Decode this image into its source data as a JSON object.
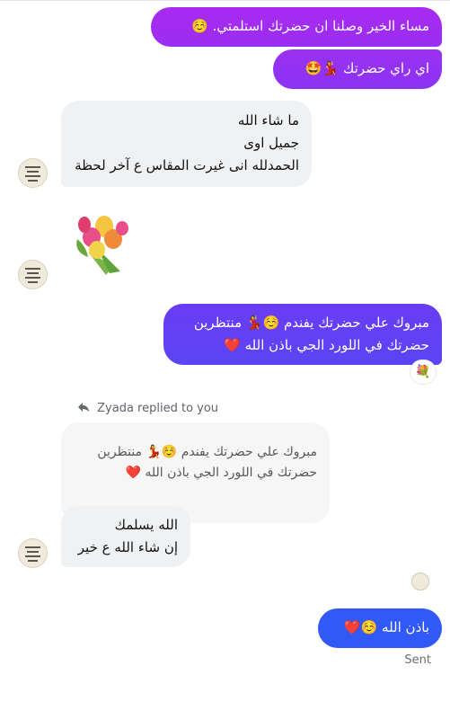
{
  "messages": {
    "m1_text": "مساء الخير وصلنا ان حضرتك استلمتي. ☺️",
    "m2_text": "اي راي حضرتك 💃🤩",
    "m3_line1": "ما شاء الله",
    "m3_line2": "جميل اوى",
    "m3_line3": "الحمدلله انى غيرت المقاس ع آخر لحظة",
    "m4_sticker": "💐",
    "m5_line1": "مبروك علي حضرتك يفندم ☺️💃 منتظرين",
    "m5_line2": "حضرتك في اللورد الجي باذن الله ❤️",
    "m5_reaction": "💐",
    "reply_header": "Zyada replied to you",
    "quoted_line1": "مبروك علي حضرتك يفندم ☺️💃 منتظرين",
    "quoted_line2": "حضرتك في اللورد الجي باذن الله ❤️",
    "m6_line1": "الله يسلمك",
    "m6_line2": "إن شاء الله ع خير",
    "m7_text": "باذن الله ☺️❤️",
    "status": "Sent"
  },
  "colors": {
    "outgoing_top": "#a528f0",
    "outgoing_mid": "#7b35f2",
    "outgoing_bottom": "#2f5cf5",
    "incoming_bg": "#f0f1f3"
  },
  "icons": {
    "reply": "reply-arrow-icon",
    "avatar": "contact-avatar"
  }
}
